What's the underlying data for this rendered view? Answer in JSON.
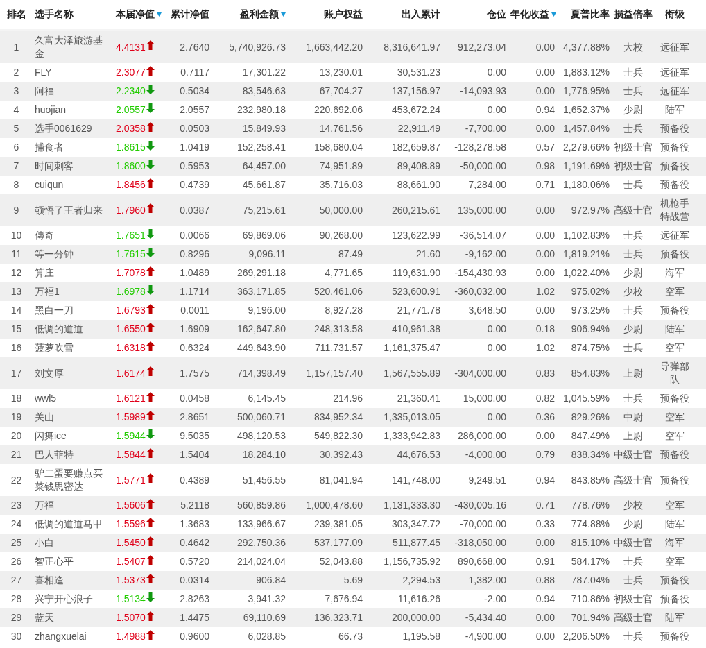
{
  "table": {
    "columns": [
      {
        "label": "排名",
        "sort_marker": false
      },
      {
        "label": "选手名称",
        "sort_marker": false
      },
      {
        "label": "本届净值",
        "sort_marker": true
      },
      {
        "label": "累计净值",
        "sort_marker": false
      },
      {
        "label": "盈利金额",
        "sort_marker": true
      },
      {
        "label": "账户权益",
        "sort_marker": false
      },
      {
        "label": "出入累计",
        "sort_marker": false
      },
      {
        "label": "仓位",
        "sort_marker": false
      },
      {
        "label": "年化收益",
        "sort_marker": true
      },
      {
        "label": "夏普比率",
        "sort_marker": false
      },
      {
        "label": "损益倍率",
        "sort_marker": false
      },
      {
        "label": "衔级",
        "sort_marker": false
      }
    ],
    "rows": [
      {
        "rising": true,
        "cells": [
          "1",
          "久富大泽旅游基金",
          "4.4131",
          "2.7640",
          "5,740,926.73",
          "1,663,442.20",
          "8,316,641.97",
          "912,273.04",
          "0.00",
          "4,377.88%",
          "大校",
          "远征军"
        ]
      },
      {
        "rising": true,
        "cells": [
          "2",
          "FLY",
          "2.3077",
          "0.7117",
          "17,301.22",
          "13,230.01",
          "30,531.23",
          "0.00",
          "0.00",
          "1,883.12%",
          "士兵",
          "远征军"
        ]
      },
      {
        "rising": false,
        "cells": [
          "3",
          "阿福",
          "2.2340",
          "0.5034",
          "83,546.63",
          "67,704.27",
          "137,156.97",
          "-14,093.93",
          "0.00",
          "1,776.95%",
          "士兵",
          "远征军"
        ]
      },
      {
        "rising": false,
        "cells": [
          "4",
          "huojian",
          "2.0557",
          "2.0557",
          "232,980.18",
          "220,692.06",
          "453,672.24",
          "0.00",
          "0.94",
          "1,652.37%",
          "少尉",
          "陆军"
        ]
      },
      {
        "rising": true,
        "cells": [
          "5",
          "选手0061629",
          "2.0358",
          "0.0503",
          "15,849.93",
          "14,761.56",
          "22,911.49",
          "-7,700.00",
          "0.00",
          "1,457.84%",
          "士兵",
          "预备役"
        ]
      },
      {
        "rising": false,
        "cells": [
          "6",
          "捕食者",
          "1.8615",
          "1.0419",
          "152,258.41",
          "158,680.04",
          "182,659.87",
          "-128,278.58",
          "0.57",
          "2,279.66%",
          "初级士官",
          "预备役"
        ]
      },
      {
        "rising": false,
        "cells": [
          "7",
          "时间刺客",
          "1.8600",
          "0.5953",
          "64,457.00",
          "74,951.89",
          "89,408.89",
          "-50,000.00",
          "0.98",
          "1,191.69%",
          "初级士官",
          "预备役"
        ]
      },
      {
        "rising": true,
        "cells": [
          "8",
          "cuiqun",
          "1.8456",
          "0.4739",
          "45,661.87",
          "35,716.03",
          "88,661.90",
          "7,284.00",
          "0.71",
          "1,180.06%",
          "士兵",
          "预备役"
        ]
      },
      {
        "rising": true,
        "cells": [
          "9",
          "顿悟了王者归来",
          "1.7960",
          "0.0387",
          "75,215.61",
          "50,000.00",
          "260,215.61",
          "135,000.00",
          "0.00",
          "972.97%",
          "高级士官",
          "机枪手特战营"
        ]
      },
      {
        "rising": false,
        "cells": [
          "10",
          "傳奇",
          "1.7651",
          "0.0066",
          "69,869.06",
          "90,268.00",
          "123,622.99",
          "-36,514.07",
          "0.00",
          "1,102.83%",
          "士兵",
          "远征军"
        ]
      },
      {
        "rising": false,
        "cells": [
          "11",
          "等一分钟",
          "1.7615",
          "0.8296",
          "9,096.11",
          "87.49",
          "21.60",
          "-9,162.00",
          "0.00",
          "1,819.21%",
          "士兵",
          "预备役"
        ]
      },
      {
        "rising": true,
        "cells": [
          "12",
          "算庄",
          "1.7078",
          "1.0489",
          "269,291.18",
          "4,771.65",
          "119,631.90",
          "-154,430.93",
          "0.00",
          "1,022.40%",
          "少尉",
          "海军"
        ]
      },
      {
        "rising": false,
        "cells": [
          "13",
          "万福1",
          "1.6978",
          "1.1714",
          "363,171.85",
          "520,461.06",
          "523,600.91",
          "-360,032.00",
          "1.02",
          "975.02%",
          "少校",
          "空军"
        ]
      },
      {
        "rising": true,
        "cells": [
          "14",
          "黑白一刀",
          "1.6793",
          "0.0011",
          "9,196.00",
          "8,927.28",
          "21,771.78",
          "3,648.50",
          "0.00",
          "973.25%",
          "士兵",
          "预备役"
        ]
      },
      {
        "rising": true,
        "cells": [
          "15",
          "低调的道道",
          "1.6550",
          "1.6909",
          "162,647.80",
          "248,313.58",
          "410,961.38",
          "0.00",
          "0.18",
          "906.94%",
          "少尉",
          "陆军"
        ]
      },
      {
        "rising": true,
        "cells": [
          "16",
          "菠萝吹雪",
          "1.6318",
          "0.6324",
          "449,643.90",
          "711,731.57",
          "1,161,375.47",
          "0.00",
          "1.02",
          "874.75%",
          "士兵",
          "空军"
        ]
      },
      {
        "rising": true,
        "cells": [
          "17",
          "刘文厚",
          "1.6174",
          "1.7575",
          "714,398.49",
          "1,157,157.40",
          "1,567,555.89",
          "-304,000.00",
          "0.83",
          "854.83%",
          "上尉",
          "导弹部队"
        ]
      },
      {
        "rising": true,
        "cells": [
          "18",
          "wwl5",
          "1.6121",
          "0.0458",
          "6,145.45",
          "214.96",
          "21,360.41",
          "15,000.00",
          "0.82",
          "1,045.59%",
          "士兵",
          "预备役"
        ]
      },
      {
        "rising": true,
        "cells": [
          "19",
          "关山",
          "1.5989",
          "2.8651",
          "500,060.71",
          "834,952.34",
          "1,335,013.05",
          "0.00",
          "0.36",
          "829.26%",
          "中尉",
          "空军"
        ]
      },
      {
        "rising": false,
        "cells": [
          "20",
          "闪舞ice",
          "1.5944",
          "9.5035",
          "498,120.53",
          "549,822.30",
          "1,333,942.83",
          "286,000.00",
          "0.00",
          "847.49%",
          "上尉",
          "空军"
        ]
      },
      {
        "rising": true,
        "cells": [
          "21",
          "巴人菲特",
          "1.5844",
          "1.5404",
          "18,284.10",
          "30,392.43",
          "44,676.53",
          "-4,000.00",
          "0.79",
          "838.34%",
          "中级士官",
          "预备役"
        ]
      },
      {
        "rising": true,
        "cells": [
          "22",
          "驴二蛋要赚点买菜钱思密达",
          "1.5771",
          "0.4389",
          "51,456.55",
          "81,041.94",
          "141,748.00",
          "9,249.51",
          "0.94",
          "843.85%",
          "高级士官",
          "预备役"
        ]
      },
      {
        "rising": true,
        "cells": [
          "23",
          "万福",
          "1.5606",
          "5.2118",
          "560,859.86",
          "1,000,478.60",
          "1,131,333.30",
          "-430,005.16",
          "0.71",
          "778.76%",
          "少校",
          "空军"
        ]
      },
      {
        "rising": true,
        "cells": [
          "24",
          "低调的道道马甲",
          "1.5596",
          "1.3683",
          "133,966.67",
          "239,381.05",
          "303,347.72",
          "-70,000.00",
          "0.33",
          "774.88%",
          "少尉",
          "陆军"
        ]
      },
      {
        "rising": true,
        "cells": [
          "25",
          "小白",
          "1.5450",
          "0.4642",
          "292,750.36",
          "537,177.09",
          "511,877.45",
          "-318,050.00",
          "0.00",
          "815.10%",
          "中级士官",
          "海军"
        ]
      },
      {
        "rising": true,
        "cells": [
          "26",
          "智正心平",
          "1.5407",
          "0.5720",
          "214,024.04",
          "52,043.88",
          "1,156,735.92",
          "890,668.00",
          "0.91",
          "584.17%",
          "士兵",
          "空军"
        ]
      },
      {
        "rising": true,
        "cells": [
          "27",
          "喜相逢",
          "1.5373",
          "0.0314",
          "906.84",
          "5.69",
          "2,294.53",
          "1,382.00",
          "0.88",
          "787.04%",
          "士兵",
          "预备役"
        ]
      },
      {
        "rising": false,
        "cells": [
          "28",
          "兴宁开心浪子",
          "1.5134",
          "2.8263",
          "3,941.32",
          "7,676.94",
          "11,616.26",
          "-2.00",
          "0.94",
          "710.86%",
          "初级士官",
          "预备役"
        ]
      },
      {
        "rising": true,
        "cells": [
          "29",
          "蓝天",
          "1.5070",
          "1.4475",
          "69,110.69",
          "136,323.71",
          "200,000.00",
          "-5,434.40",
          "0.00",
          "701.94%",
          "高级士官",
          "陆军"
        ]
      },
      {
        "rising": true,
        "cells": [
          "30",
          "zhangxuelai",
          "1.4988",
          "0.9600",
          "6,028.85",
          "66.73",
          "1,195.58",
          "-4,900.00",
          "0.00",
          "2,206.50%",
          "士兵",
          "预备役"
        ]
      }
    ]
  }
}
